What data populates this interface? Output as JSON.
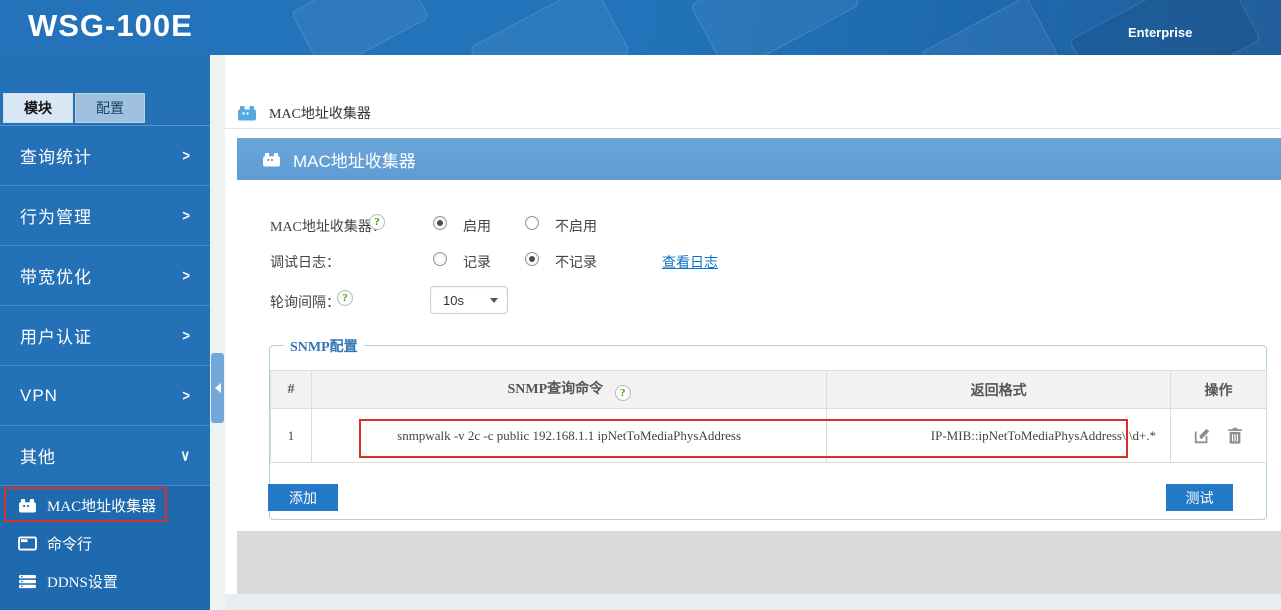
{
  "app": {
    "logo": "WSG-100E",
    "edition": "Enterprise"
  },
  "colors": {
    "topbar_blue": "#2273b9",
    "sidebar_blue": "#2471b7",
    "panel_header_blue": "#64a1d7",
    "button_blue": "#2478c8",
    "annotation_red": "#da2f28",
    "link_blue": "#0d72c8",
    "help_green": "#3c9a1e"
  },
  "sidebar": {
    "tabs": [
      {
        "label": "模块",
        "active": true
      },
      {
        "label": "配置",
        "active": false
      }
    ],
    "menu": [
      {
        "label": "查询统计",
        "arrow": ">"
      },
      {
        "label": "行为管理",
        "arrow": ">"
      },
      {
        "label": "带宽优化",
        "arrow": ">"
      },
      {
        "label": "用户认证",
        "arrow": ">"
      },
      {
        "label": "VPN",
        "arrow": ">"
      },
      {
        "label": "其他",
        "arrow": "∨",
        "expanded": true
      }
    ],
    "submenu": [
      {
        "label": "MAC地址收集器",
        "icon": "collector-icon",
        "selected": true
      },
      {
        "label": "命令行",
        "icon": "terminal-icon",
        "selected": false
      },
      {
        "label": "DDNS设置",
        "icon": "server-icon",
        "selected": false
      }
    ]
  },
  "breadcrumb": {
    "label": "MAC地址收集器",
    "icon": "collector-icon"
  },
  "panel": {
    "title": "MAC地址收集器",
    "icon": "collector-icon"
  },
  "form": {
    "collector": {
      "label": "MAC地址收集器：",
      "has_help": true,
      "options": [
        {
          "label": "启用",
          "checked": true
        },
        {
          "label": "不启用",
          "checked": false
        }
      ]
    },
    "debug_log": {
      "label": "调试日志：",
      "options": [
        {
          "label": "记录",
          "checked": false
        },
        {
          "label": "不记录",
          "checked": true
        }
      ],
      "view_log_link": "查看日志"
    },
    "poll_interval": {
      "label": "轮询间隔：",
      "has_help": true,
      "select_value": "10s"
    },
    "help_glyph": "?"
  },
  "snmp": {
    "legend": "SNMP配置",
    "table": {
      "headers": {
        "index": "#",
        "command": "SNMP查询命令",
        "format": "返回格式",
        "ops": "操作"
      },
      "rows": [
        {
          "index": "1",
          "command": "snmpwalk -v 2c -c public 192.168.1.1 ipNetToMediaPhysAddress",
          "format": "IP-MIB::ipNetToMediaPhysAddress\\.\\d+.*"
        }
      ]
    },
    "add_label": "添加",
    "test_label": "测试"
  }
}
